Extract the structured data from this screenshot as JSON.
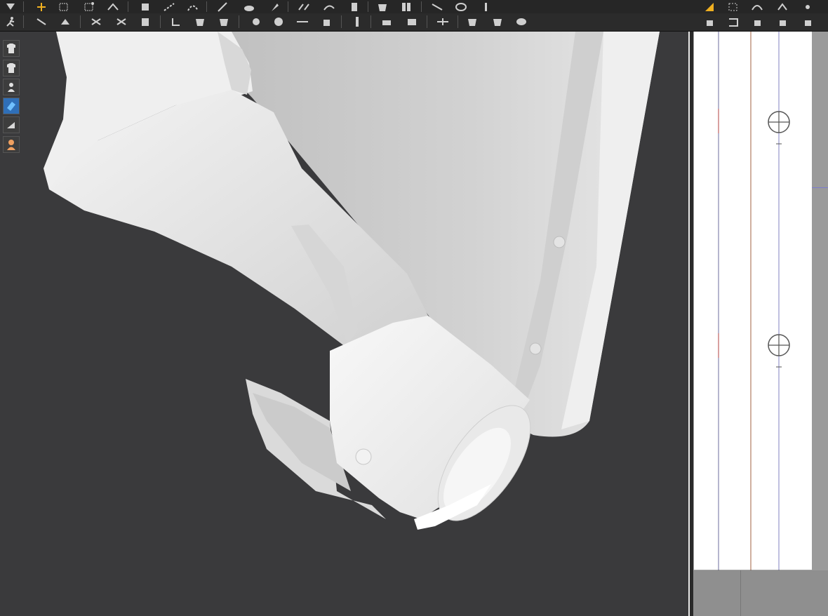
{
  "app": {
    "accent_color": "#f0b020",
    "viewport_bg": "#3a3a3c",
    "pattern_bg": "#ffffff"
  },
  "toolbar_top": {
    "tools": [
      "select-icon",
      "move-icon",
      "transform-box-icon",
      "transform-points-icon",
      "edit-curve-icon",
      "add-point-icon",
      "segment-icon",
      "curve-icon",
      "pen-icon",
      "brush-icon",
      "pin-icon",
      "sew-icon",
      "fold-icon",
      "zip-icon",
      "avatar-icon",
      "garment-icon",
      "layer-icon",
      "measure-icon",
      "tack-icon",
      "wrap-icon",
      "pattern-select-icon",
      "pattern-transform-icon",
      "pattern-curve-icon",
      "pattern-pen-icon"
    ]
  },
  "toolbar_bottom": {
    "tools": [
      "animation-icon",
      "pin-tool-icon",
      "fold-arrange-icon",
      "texture-icon",
      "graphic-icon",
      "puckering-icon",
      "zipper-icon",
      "shirt-icon",
      "button-icon",
      "buttonhole-icon",
      "line-icon",
      "lock-icon",
      "zip-slider-icon",
      "flat-sew-icon",
      "strengthen-icon",
      "sync-icon",
      "shirt-left-icon",
      "shirt-right-icon",
      "hanger-icon",
      "pattern-sew-icon",
      "pattern-internal-icon",
      "pattern-notch-icon",
      "pattern-fold-icon"
    ]
  },
  "side_toolbar": {
    "tools": [
      "show-garment-icon",
      "show-garment-solid-icon",
      "show-avatar-icon",
      "fabric-render-icon",
      "texture-mode-icon",
      "avatar-skin-icon"
    ]
  },
  "pattern_window": {
    "button_markers": 2
  }
}
